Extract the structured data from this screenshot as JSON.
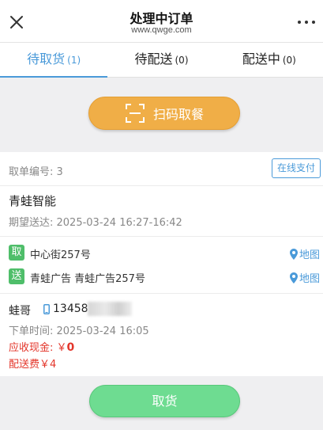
{
  "header": {
    "title": "处理中订单",
    "subtitle": "www.qwge.com"
  },
  "tabs": [
    {
      "label": "待取货",
      "count": "(1)",
      "active": true
    },
    {
      "label": "待配送",
      "count": "(0)",
      "active": false
    },
    {
      "label": "配送中",
      "count": "(0)",
      "active": false
    }
  ],
  "scan": {
    "label": "扫码取餐"
  },
  "order": {
    "number_label": "取单编号: 3",
    "payment_badge": "在线支付",
    "shop_name": "青蛙智能",
    "expected_delivery": "期望送达: 2025-03-24 16:27-16:42",
    "pickup": {
      "tag": "取",
      "address": "中心街257号",
      "map_label": "地图"
    },
    "delivery": {
      "tag": "送",
      "address": "青蛙广告 青蛙广告257号",
      "map_label": "地图"
    },
    "customer_name": "蛙哥",
    "customer_phone": "13458",
    "order_time": "下单时间: 2025-03-24 16:05",
    "cash_label": "应收现金: ￥",
    "cash_value": "0",
    "delivery_fee": "配送费￥4"
  },
  "footer": {
    "pickup_label": "取货"
  },
  "colors": {
    "accent_blue": "#4a9ad9",
    "scan_orange": "#f0ae47",
    "tag_green": "#4fbe6a",
    "pickup_green": "#6edc91",
    "price_red": "#e3352a"
  },
  "icons": [
    "close-icon",
    "more-dots-icon",
    "scan-frame-icon",
    "location-pin-icon",
    "phone-icon"
  ]
}
